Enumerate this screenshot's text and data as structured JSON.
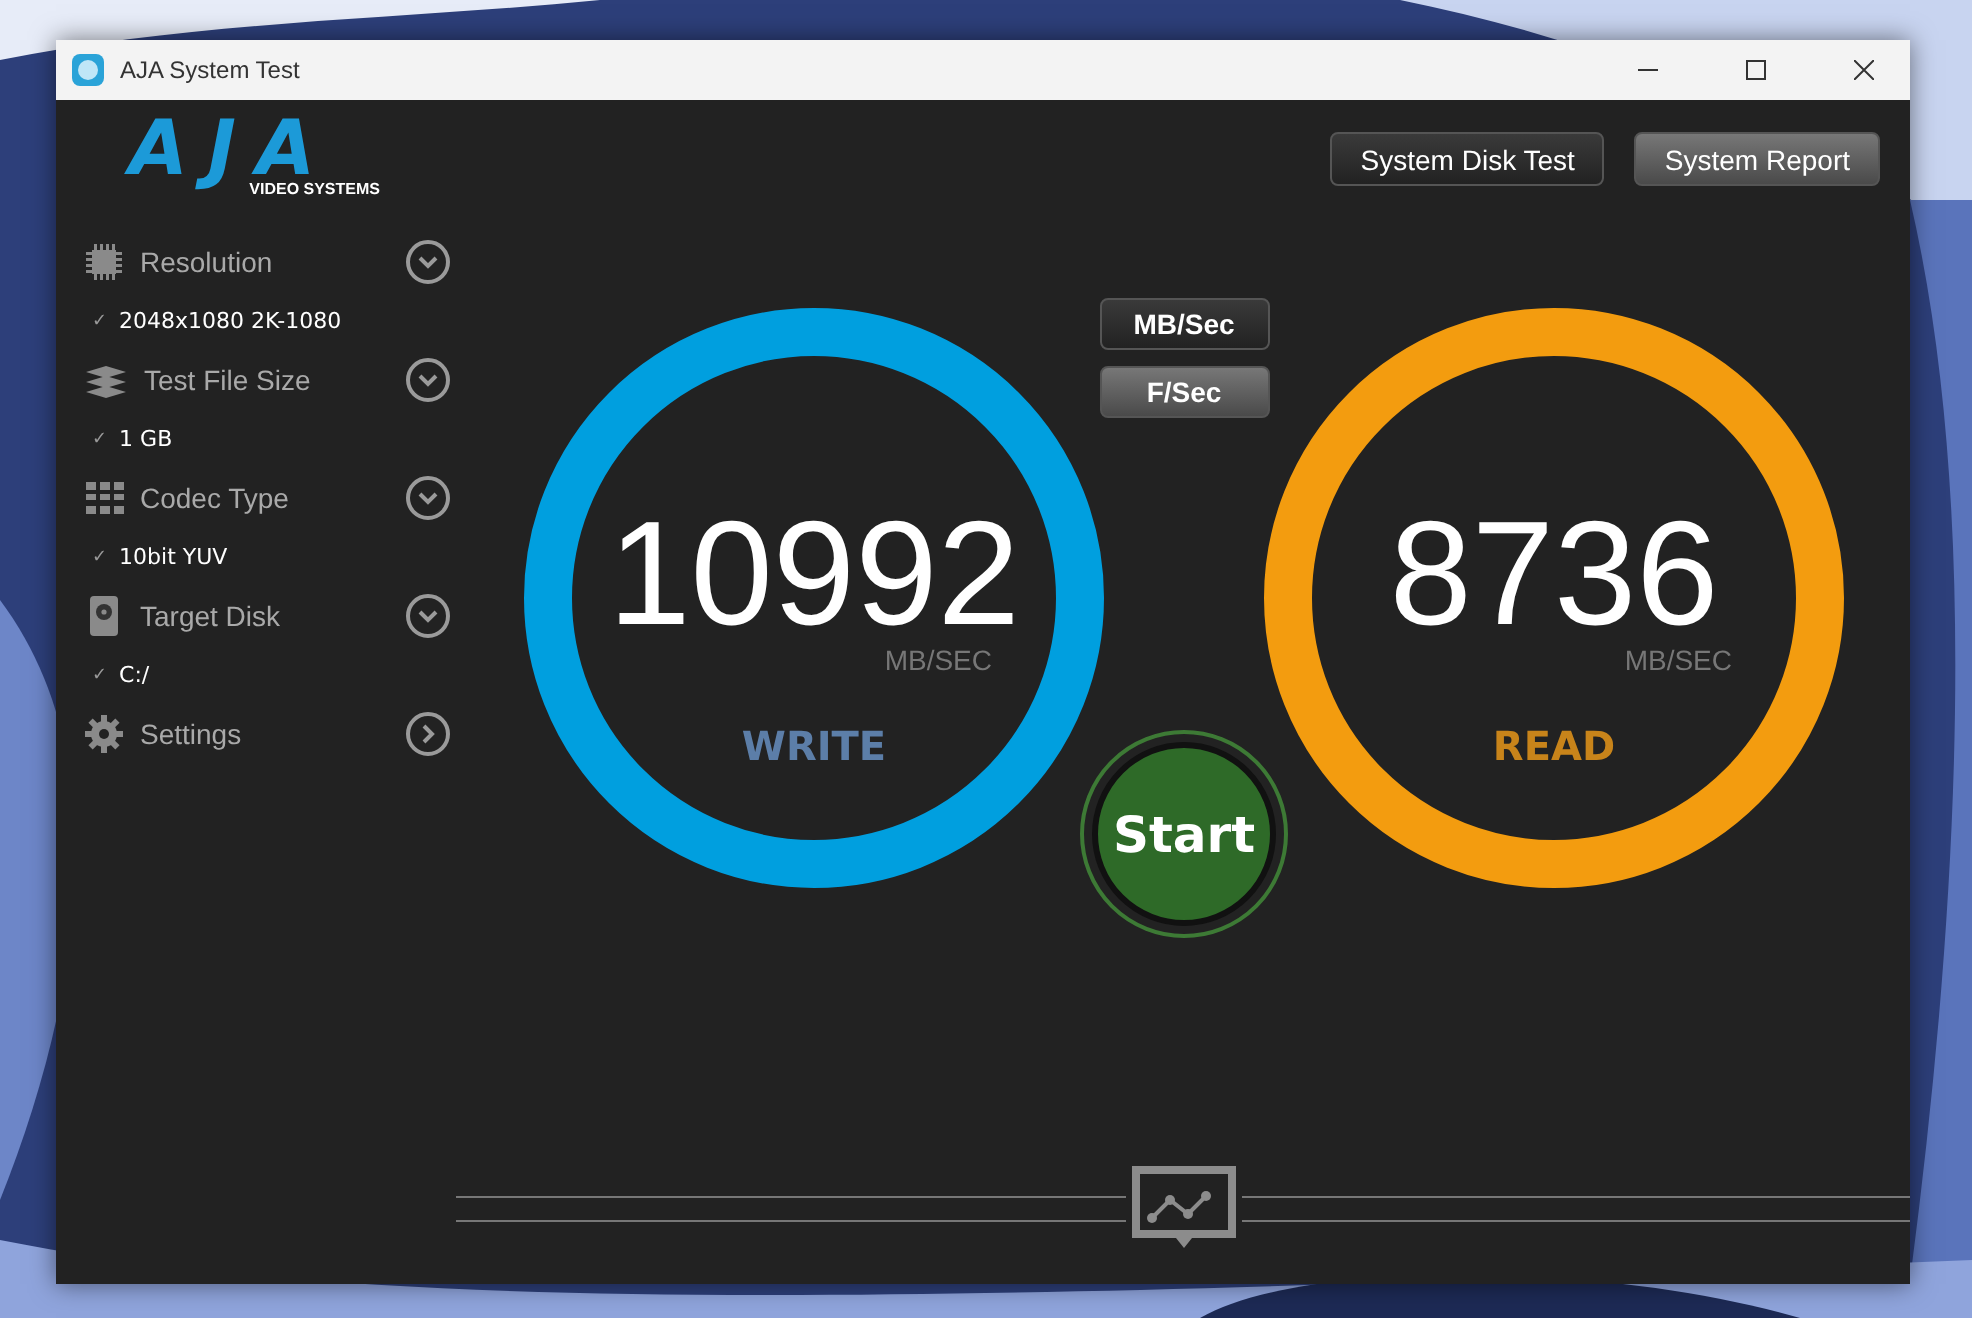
{
  "window": {
    "title": "AJA System Test"
  },
  "logo": {
    "brand": "AJA",
    "tagline": "VIDEO SYSTEMS"
  },
  "sidebar": {
    "items": [
      {
        "kind": "select",
        "label": "Resolution",
        "check": "✓",
        "value": "2048x1080 2K-1080"
      },
      {
        "kind": "select",
        "label": "Test File Size",
        "check": "✓",
        "value": "1 GB"
      },
      {
        "kind": "select",
        "label": "Codec Type",
        "check": "✓",
        "value": "10bit YUV"
      },
      {
        "kind": "select",
        "label": "Target Disk",
        "check": "✓",
        "value": "C:/"
      },
      {
        "kind": "page",
        "label": "Settings"
      }
    ]
  },
  "top_buttons": [
    {
      "label": "System Disk Test",
      "selected": false
    },
    {
      "label": "System Report",
      "selected": true
    }
  ],
  "units": [
    {
      "label": "MB/Sec",
      "selected": false
    },
    {
      "label": "F/Sec",
      "selected": true
    }
  ],
  "gauges": [
    {
      "value": "10992",
      "unit": "MB/SEC",
      "label": "WRITE",
      "color": "#009fdf"
    },
    {
      "value": "8736",
      "unit": "MB/SEC",
      "label": "READ",
      "color": "#f39c0f"
    }
  ],
  "start_button": {
    "label": "Start"
  }
}
